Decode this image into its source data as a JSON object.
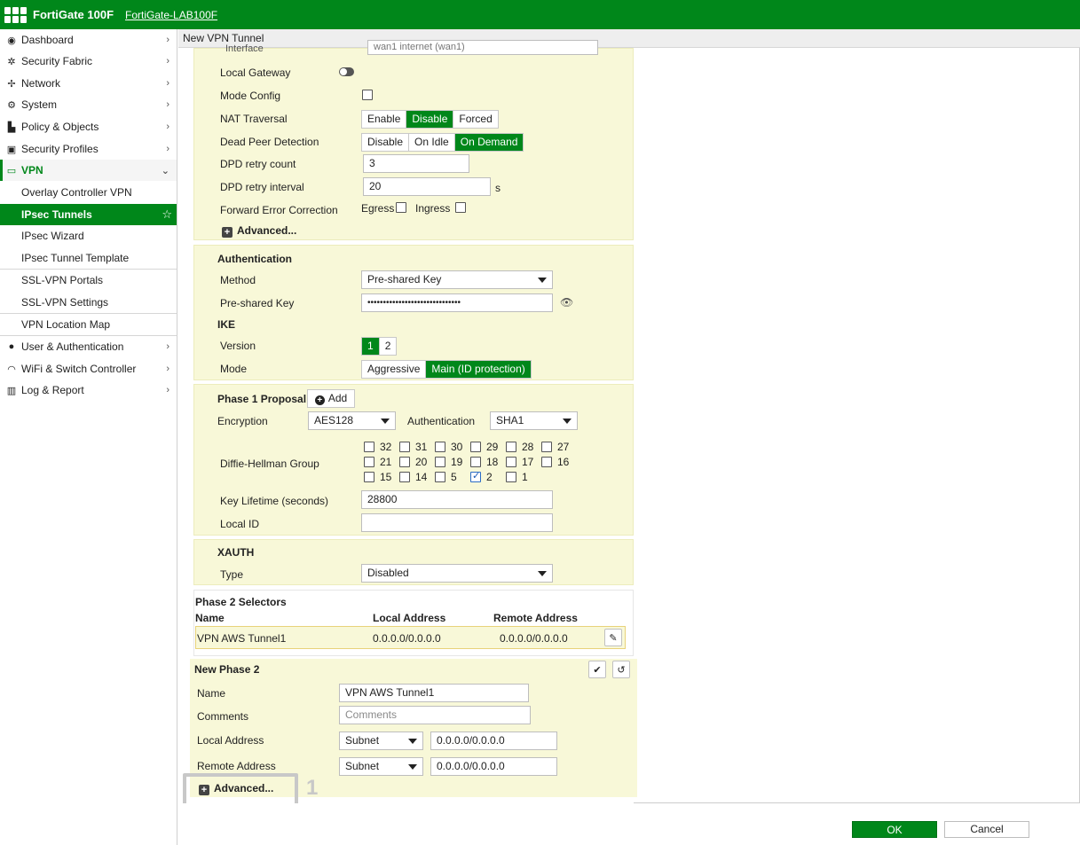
{
  "topbar": {
    "brand": "FortiGate 100F",
    "hostname": "FortiGate-LAB100F"
  },
  "sidebar": {
    "items": [
      {
        "label": "Dashboard",
        "icon": "dashboard-icon"
      },
      {
        "label": "Security Fabric",
        "icon": "security-fabric-icon"
      },
      {
        "label": "Network",
        "icon": "network-icon"
      },
      {
        "label": "System",
        "icon": "gear-icon"
      },
      {
        "label": "Policy & Objects",
        "icon": "policy-icon"
      },
      {
        "label": "Security Profiles",
        "icon": "lock-icon"
      },
      {
        "label": "VPN",
        "icon": "laptop-icon"
      },
      {
        "label": "Overlay Controller VPN"
      },
      {
        "label": "IPsec Tunnels"
      },
      {
        "label": "IPsec Wizard"
      },
      {
        "label": "IPsec Tunnel Template"
      },
      {
        "label": "SSL-VPN Portals"
      },
      {
        "label": "SSL-VPN Settings"
      },
      {
        "label": "VPN Location Map"
      },
      {
        "label": "User & Authentication",
        "icon": "user-icon"
      },
      {
        "label": "WiFi & Switch Controller",
        "icon": "wifi-icon"
      },
      {
        "label": "Log & Report",
        "icon": "chart-icon"
      }
    ]
  },
  "page": {
    "title": "New VPN Tunnel"
  },
  "network": {
    "interface_label": "Interface",
    "interface_value": "wan1 internet (wan1)",
    "local_gateway": "Local Gateway",
    "mode_config": "Mode Config",
    "nat_traversal": {
      "label": "NAT Traversal",
      "options": [
        "Enable",
        "Disable",
        "Forced"
      ],
      "selected": "Disable"
    },
    "dpd": {
      "label": "Dead Peer Detection",
      "options": [
        "Disable",
        "On Idle",
        "On Demand"
      ],
      "selected": "On Demand"
    },
    "dpd_retry_count": {
      "label": "DPD retry count",
      "value": "3"
    },
    "dpd_retry_interval": {
      "label": "DPD retry interval",
      "value": "20",
      "unit": "s"
    },
    "fec": {
      "label": "Forward Error Correction",
      "egress": "Egress",
      "ingress": "Ingress"
    },
    "advanced": "Advanced..."
  },
  "authentication": {
    "title": "Authentication",
    "method_label": "Method",
    "method_value": "Pre-shared Key",
    "psk_label": "Pre-shared Key",
    "psk_value": "••••••••••••••••••••••••••••••",
    "ike_title": "IKE",
    "version_label": "Version",
    "version_options": [
      "1",
      "2"
    ],
    "version_selected": "1",
    "mode_label": "Mode",
    "mode_options": [
      "Aggressive",
      "Main (ID protection)"
    ],
    "mode_selected": "Main (ID protection)"
  },
  "phase1": {
    "title": "Phase 1 Proposal",
    "add": "Add",
    "encryption_label": "Encryption",
    "encryption_value": "AES128",
    "auth_label": "Authentication",
    "auth_value": "SHA1",
    "dh_label": "Diffie-Hellman Group",
    "dh_groups": [
      [
        "32",
        "31",
        "30",
        "29",
        "28",
        "27"
      ],
      [
        "21",
        "20",
        "19",
        "18",
        "17",
        "16"
      ],
      [
        "15",
        "14",
        "5",
        "2",
        "1"
      ]
    ],
    "dh_checked": "2",
    "key_lifetime_label": "Key Lifetime (seconds)",
    "key_lifetime_value": "28800",
    "local_id_label": "Local ID",
    "local_id_value": ""
  },
  "xauth": {
    "title": "XAUTH",
    "type_label": "Type",
    "type_value": "Disabled"
  },
  "phase2": {
    "title": "Phase 2 Selectors",
    "columns": [
      "Name",
      "Local Address",
      "Remote Address"
    ],
    "rows": [
      [
        "VPN AWS Tunnel1",
        "0.0.0.0/0.0.0.0",
        "0.0.0.0/0.0.0.0"
      ]
    ]
  },
  "new_phase2": {
    "title": "New Phase 2",
    "name_label": "Name",
    "name_value": "VPN AWS Tunnel1",
    "comments_label": "Comments",
    "comments_placeholder": "Comments",
    "local_label": "Local Address",
    "local_type": "Subnet",
    "local_value": "0.0.0.0/0.0.0.0",
    "remote_label": "Remote Address",
    "remote_type": "Subnet",
    "remote_value": "0.0.0.0/0.0.0.0",
    "advanced": "Advanced...",
    "callout": "1"
  },
  "footer": {
    "ok": "OK",
    "cancel": "Cancel"
  },
  "colors": {
    "brand_green": "#00871a",
    "panel_bg": "#f8f8d8"
  }
}
